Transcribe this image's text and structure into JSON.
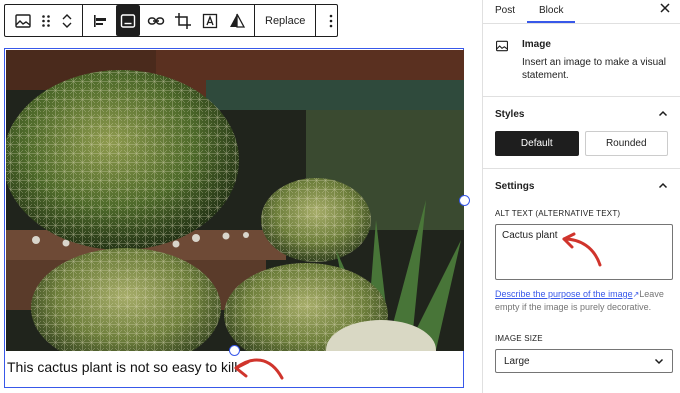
{
  "toolbar": {
    "buttons": [
      {
        "icon": "image-icon"
      },
      {
        "icon": "drag-handle-icon"
      },
      {
        "icon": "move-up-down-icon"
      },
      {
        "icon": "align-left-icon"
      },
      {
        "icon": "caption-icon"
      },
      {
        "icon": "link-icon"
      },
      {
        "icon": "crop-icon"
      },
      {
        "icon": "text-overlay-icon"
      },
      {
        "icon": "duotone-icon"
      }
    ],
    "replace_label": "Replace",
    "more_icon": "more-vertical-icon"
  },
  "image_block": {
    "caption": "This cactus plant is not so easy to kill."
  },
  "sidebar": {
    "tabs": [
      "Post",
      "Block"
    ],
    "active_tab": "Block",
    "close_icon": "close-icon",
    "block": {
      "title": "Image",
      "description": "Insert an image to make a visual statement."
    },
    "styles": {
      "title": "Styles",
      "options": [
        "Default",
        "Rounded"
      ],
      "selected": "Default"
    },
    "settings": {
      "title": "Settings",
      "alt_text_label": "ALT TEXT (ALTERNATIVE TEXT)",
      "alt_text_value": "Cactus plant",
      "help_link": "Describe the purpose of the image",
      "help_rest": "Leave empty if the image is purely decorative.",
      "image_size_label": "IMAGE SIZE",
      "image_size_value": "Large"
    }
  },
  "colors": {
    "accent": "#3858e9",
    "annotation_arrow": "#d0342c"
  }
}
